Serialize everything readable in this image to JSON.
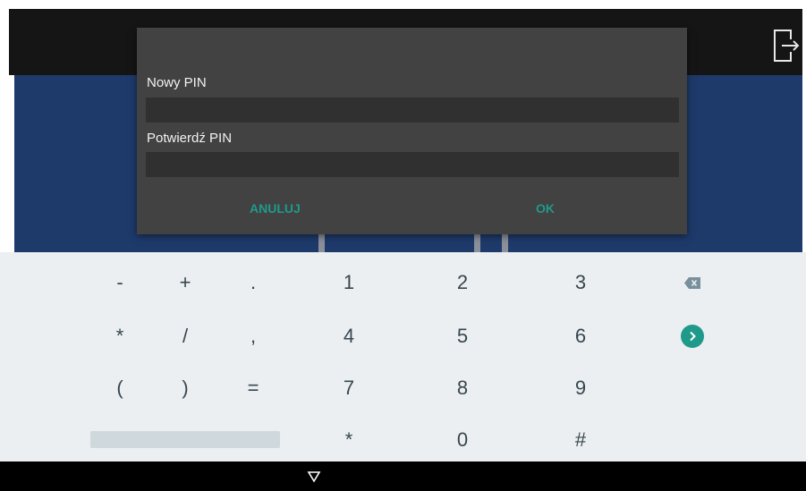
{
  "dialog": {
    "new_pin_label": "Nowy PIN",
    "new_pin_value": "",
    "confirm_pin_label": "Potwierdź PIN",
    "confirm_pin_value": "",
    "cancel_label": "ANULUJ",
    "ok_label": "OK"
  },
  "keyboard": {
    "row1": [
      "-",
      "+",
      ".",
      "1",
      "2",
      "3"
    ],
    "row2": [
      "*",
      "/",
      ",",
      "4",
      "5",
      "6"
    ],
    "row3": [
      "(",
      ")",
      "=",
      "7",
      "8",
      "9"
    ],
    "row4": [
      "*",
      "0",
      "#"
    ],
    "backspace_icon": "backspace-icon",
    "next_icon": "next-arrow-icon"
  },
  "navbar": {
    "back_icon": "back-triangle-icon"
  },
  "header": {
    "exit_icon": "exit-icon"
  },
  "colors": {
    "accent": "#1f9a8a",
    "dialog_bg": "#424242",
    "field_bg": "#303030",
    "background_blue": "#1e3a6b",
    "keyboard_bg": "#eceff1",
    "key_text": "#37474f"
  }
}
